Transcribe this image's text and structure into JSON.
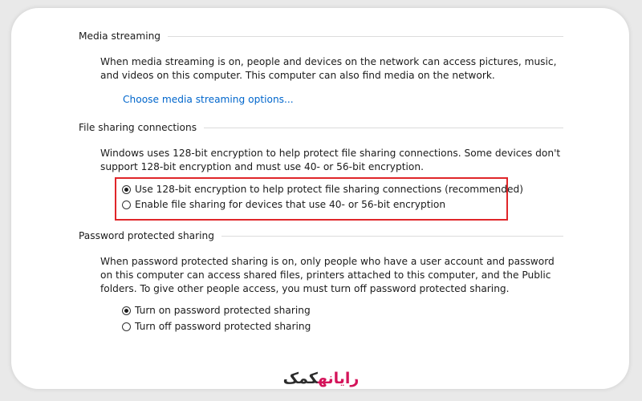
{
  "media_streaming": {
    "heading": "Media streaming",
    "description": "When media streaming is on, people and devices on the network can access pictures, music, and videos on this computer. This computer can also find media on the network.",
    "link_label": "Choose media streaming options..."
  },
  "file_sharing": {
    "heading": "File sharing connections",
    "description": "Windows uses 128-bit encryption to help protect file sharing connections. Some devices don't support 128-bit encryption and must use 40- or 56-bit encryption.",
    "options": [
      {
        "label": "Use 128-bit encryption to help protect file sharing connections (recommended)",
        "selected": true
      },
      {
        "label": "Enable file sharing for devices that use 40- or 56-bit encryption",
        "selected": false
      }
    ]
  },
  "password_sharing": {
    "heading": "Password protected sharing",
    "description": "When password protected sharing is on, only people who have a user account and password on this computer can access shared files, printers attached to this computer, and the Public folders. To give other people access, you must turn off password protected sharing.",
    "options": [
      {
        "label": "Turn on password protected sharing",
        "selected": true
      },
      {
        "label": "Turn off password protected sharing",
        "selected": false
      }
    ]
  },
  "watermark": {
    "part1": "رایانه",
    "part2": "کمک"
  },
  "colors": {
    "highlight": "#e0262a",
    "link": "#0066cc",
    "brand": "#d4145a"
  }
}
